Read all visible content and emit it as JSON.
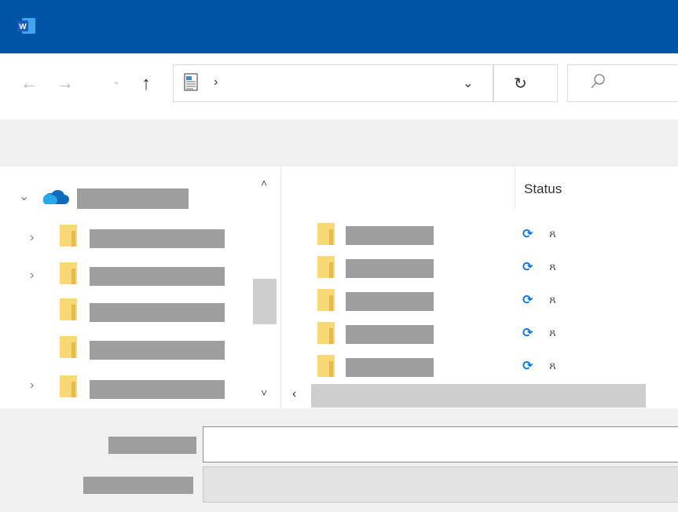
{
  "window": {
    "app_icon": "word-icon",
    "title": ""
  },
  "navigation": {
    "back_icon": "←",
    "forward_icon": "→",
    "recent_icon": "⌄",
    "up_icon": "↑",
    "address_separator": "›",
    "address_dropdown_icon": "⌄",
    "refresh_icon": "↻",
    "search_placeholder": ""
  },
  "nav_pane": {
    "onedrive": {
      "label": "",
      "expanded": true,
      "expander": "⌄"
    },
    "folders": [
      {
        "label": "",
        "expander": "›"
      },
      {
        "label": "",
        "expander": "›"
      },
      {
        "label": "",
        "expander": ""
      },
      {
        "label": "",
        "expander": ""
      },
      {
        "label": "",
        "expander": "›"
      }
    ],
    "scroll_up": "˄",
    "scroll_down": "˅"
  },
  "content": {
    "columns": {
      "status": "Status"
    },
    "rows": [
      {
        "name": "",
        "status_sync": "⟳",
        "status_user": "ጸ"
      },
      {
        "name": "",
        "status_sync": "⟳",
        "status_user": "ጸ"
      },
      {
        "name": "",
        "status_sync": "⟳",
        "status_user": "ጸ"
      },
      {
        "name": "",
        "status_sync": "⟳",
        "status_user": "ጸ"
      },
      {
        "name": "",
        "status_sync": "⟳",
        "status_user": "ጸ"
      }
    ],
    "hscroll_left": "‹"
  },
  "bottom": {
    "file_name_label": "",
    "file_name_value": "",
    "save_as_type_label": "",
    "save_as_type_value": ""
  },
  "colors": {
    "titlebar": "#0054a6",
    "folder": "#f8d775",
    "sync": "#0a74da",
    "onedrive": "#0f6cbd"
  }
}
